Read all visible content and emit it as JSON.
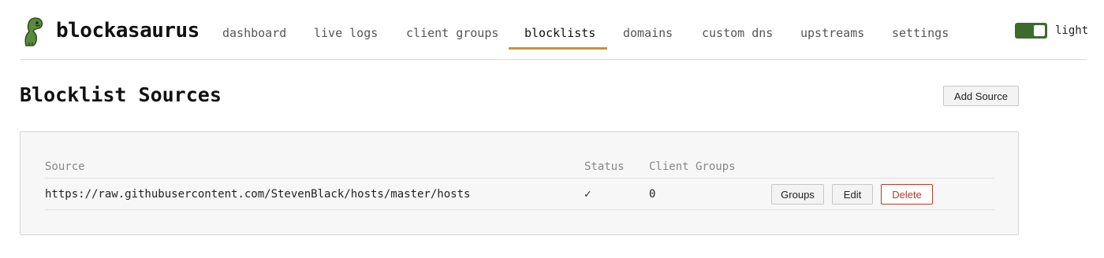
{
  "header": {
    "brand": "blockasaurus",
    "logo_icon": "dinosaur-icon",
    "nav": [
      {
        "label": "dashboard"
      },
      {
        "label": "live logs"
      },
      {
        "label": "client groups"
      },
      {
        "label": "blocklists",
        "active": true
      },
      {
        "label": "domains"
      },
      {
        "label": "custom dns"
      },
      {
        "label": "upstreams"
      },
      {
        "label": "settings"
      }
    ],
    "theme_toggle": {
      "label": "light",
      "on": true
    }
  },
  "colors": {
    "accent_underline": "#c8923a",
    "toggle_green": "#3d6b2c",
    "danger": "#b03a2e",
    "logo_green": "#5a8a3a"
  },
  "page": {
    "title": "Blocklist Sources",
    "add_button": "Add Source"
  },
  "table": {
    "columns": [
      "Source",
      "Status",
      "Client Groups"
    ],
    "rows": [
      {
        "source": "https://raw.githubusercontent.com/StevenBlack/hosts/master/hosts",
        "status": "✓",
        "client_groups": "0",
        "actions": {
          "groups": "Groups",
          "edit": "Edit",
          "delete": "Delete"
        }
      }
    ]
  }
}
